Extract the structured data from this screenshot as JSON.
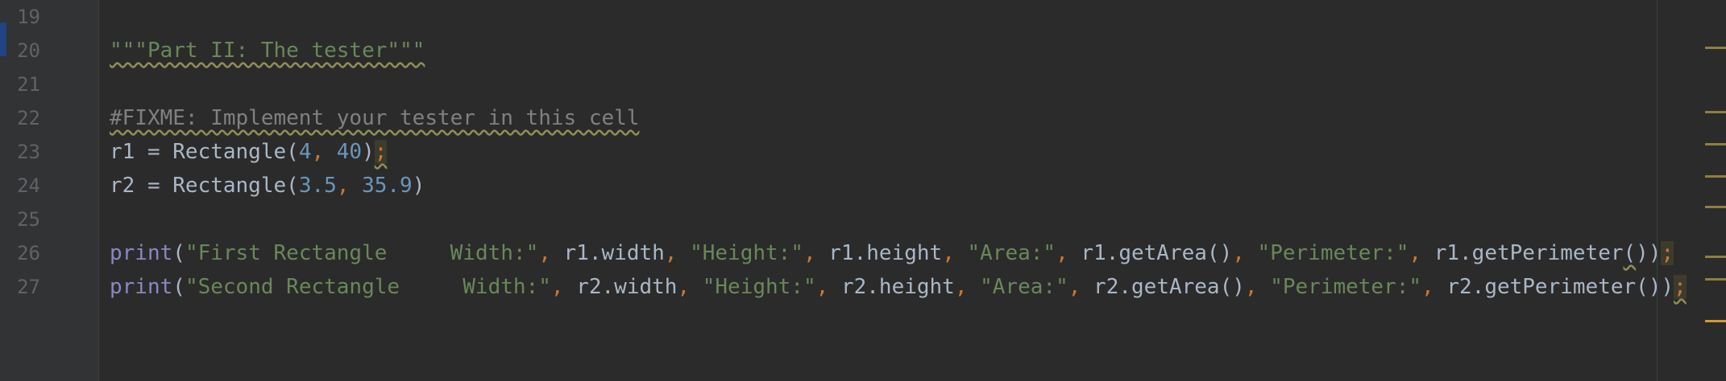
{
  "editor": {
    "lines": [
      {
        "num": "19",
        "tokens": []
      },
      {
        "num": "20",
        "tokens": [
          {
            "text": "\"\"\"Part II: The tester\"\"\"",
            "cls": "t-string t-sq"
          }
        ]
      },
      {
        "num": "21",
        "tokens": []
      },
      {
        "num": "22",
        "tokens": [
          {
            "text": "#FIXME: Implement your tester in this cell",
            "cls": "t-comment t-sq"
          }
        ]
      },
      {
        "num": "23",
        "tokens": [
          {
            "text": "r1 = Rectangle(",
            "cls": "t-default"
          },
          {
            "text": "4",
            "cls": "t-number"
          },
          {
            "text": ", ",
            "cls": "t-punct"
          },
          {
            "text": "40",
            "cls": "t-number"
          },
          {
            "text": ")",
            "cls": "t-default"
          },
          {
            "text": ";",
            "cls": "t-punct t-hl t-sq"
          }
        ]
      },
      {
        "num": "24",
        "tokens": [
          {
            "text": "r2 = Rectangle(",
            "cls": "t-default"
          },
          {
            "text": "3.5",
            "cls": "t-number"
          },
          {
            "text": ", ",
            "cls": "t-punct"
          },
          {
            "text": "35.9",
            "cls": "t-number"
          },
          {
            "text": ")",
            "cls": "t-default"
          }
        ]
      },
      {
        "num": "25",
        "tokens": []
      },
      {
        "num": "26",
        "tokens": [
          {
            "text": "print",
            "cls": "t-builtin"
          },
          {
            "text": "(",
            "cls": "t-default"
          },
          {
            "text": "\"First Rectangle     Width:\"",
            "cls": "t-string"
          },
          {
            "text": ", ",
            "cls": "t-punct"
          },
          {
            "text": "r1.width",
            "cls": "t-default"
          },
          {
            "text": ", ",
            "cls": "t-punct"
          },
          {
            "text": "\"Height:\"",
            "cls": "t-string"
          },
          {
            "text": ", ",
            "cls": "t-punct"
          },
          {
            "text": "r1.height",
            "cls": "t-default"
          },
          {
            "text": ", ",
            "cls": "t-punct"
          },
          {
            "text": "\"Area:\"",
            "cls": "t-string"
          },
          {
            "text": ", ",
            "cls": "t-punct"
          },
          {
            "text": "r1.getArea()",
            "cls": "t-default"
          },
          {
            "text": ", ",
            "cls": "t-punct"
          },
          {
            "text": "\"Perimeter:\"",
            "cls": "t-string"
          },
          {
            "text": ", ",
            "cls": "t-punct"
          },
          {
            "text": "r1.getPerimeter",
            "cls": "t-default"
          },
          {
            "text": "(",
            "cls": "t-default t-sq"
          },
          {
            "text": "))",
            "cls": "t-default"
          },
          {
            "text": ";",
            "cls": "t-punct t-hl"
          }
        ]
      },
      {
        "num": "27",
        "tokens": [
          {
            "text": "print",
            "cls": "t-builtin"
          },
          {
            "text": "(",
            "cls": "t-default"
          },
          {
            "text": "\"Second Rectangle     Width:\"",
            "cls": "t-string"
          },
          {
            "text": ", ",
            "cls": "t-punct"
          },
          {
            "text": "r2.width",
            "cls": "t-default"
          },
          {
            "text": ", ",
            "cls": "t-punct"
          },
          {
            "text": "\"Height:\"",
            "cls": "t-string"
          },
          {
            "text": ", ",
            "cls": "t-punct"
          },
          {
            "text": "r2.height",
            "cls": "t-default"
          },
          {
            "text": ", ",
            "cls": "t-punct"
          },
          {
            "text": "\"Area:\"",
            "cls": "t-string"
          },
          {
            "text": ", ",
            "cls": "t-punct"
          },
          {
            "text": "r2.getArea()",
            "cls": "t-default"
          },
          {
            "text": ", ",
            "cls": "t-punct"
          },
          {
            "text": "\"Perimeter:\"",
            "cls": "t-string"
          },
          {
            "text": ", ",
            "cls": "t-punct"
          },
          {
            "text": "r2.getPerimeter",
            "cls": "t-default"
          },
          {
            "text": "())",
            "cls": "t-default"
          },
          {
            "text": ";",
            "cls": "t-punct t-hl t-sq"
          }
        ]
      }
    ]
  },
  "colors": {
    "background": "#2b2b2b",
    "gutter": "#313335",
    "string": "#6a8759",
    "number": "#6897bb",
    "comment": "#808080",
    "builtin": "#8888c6",
    "keyword_punct": "#cc7832",
    "identifier": "#a9b7c6",
    "warning_mark": "#8f7f3c"
  }
}
